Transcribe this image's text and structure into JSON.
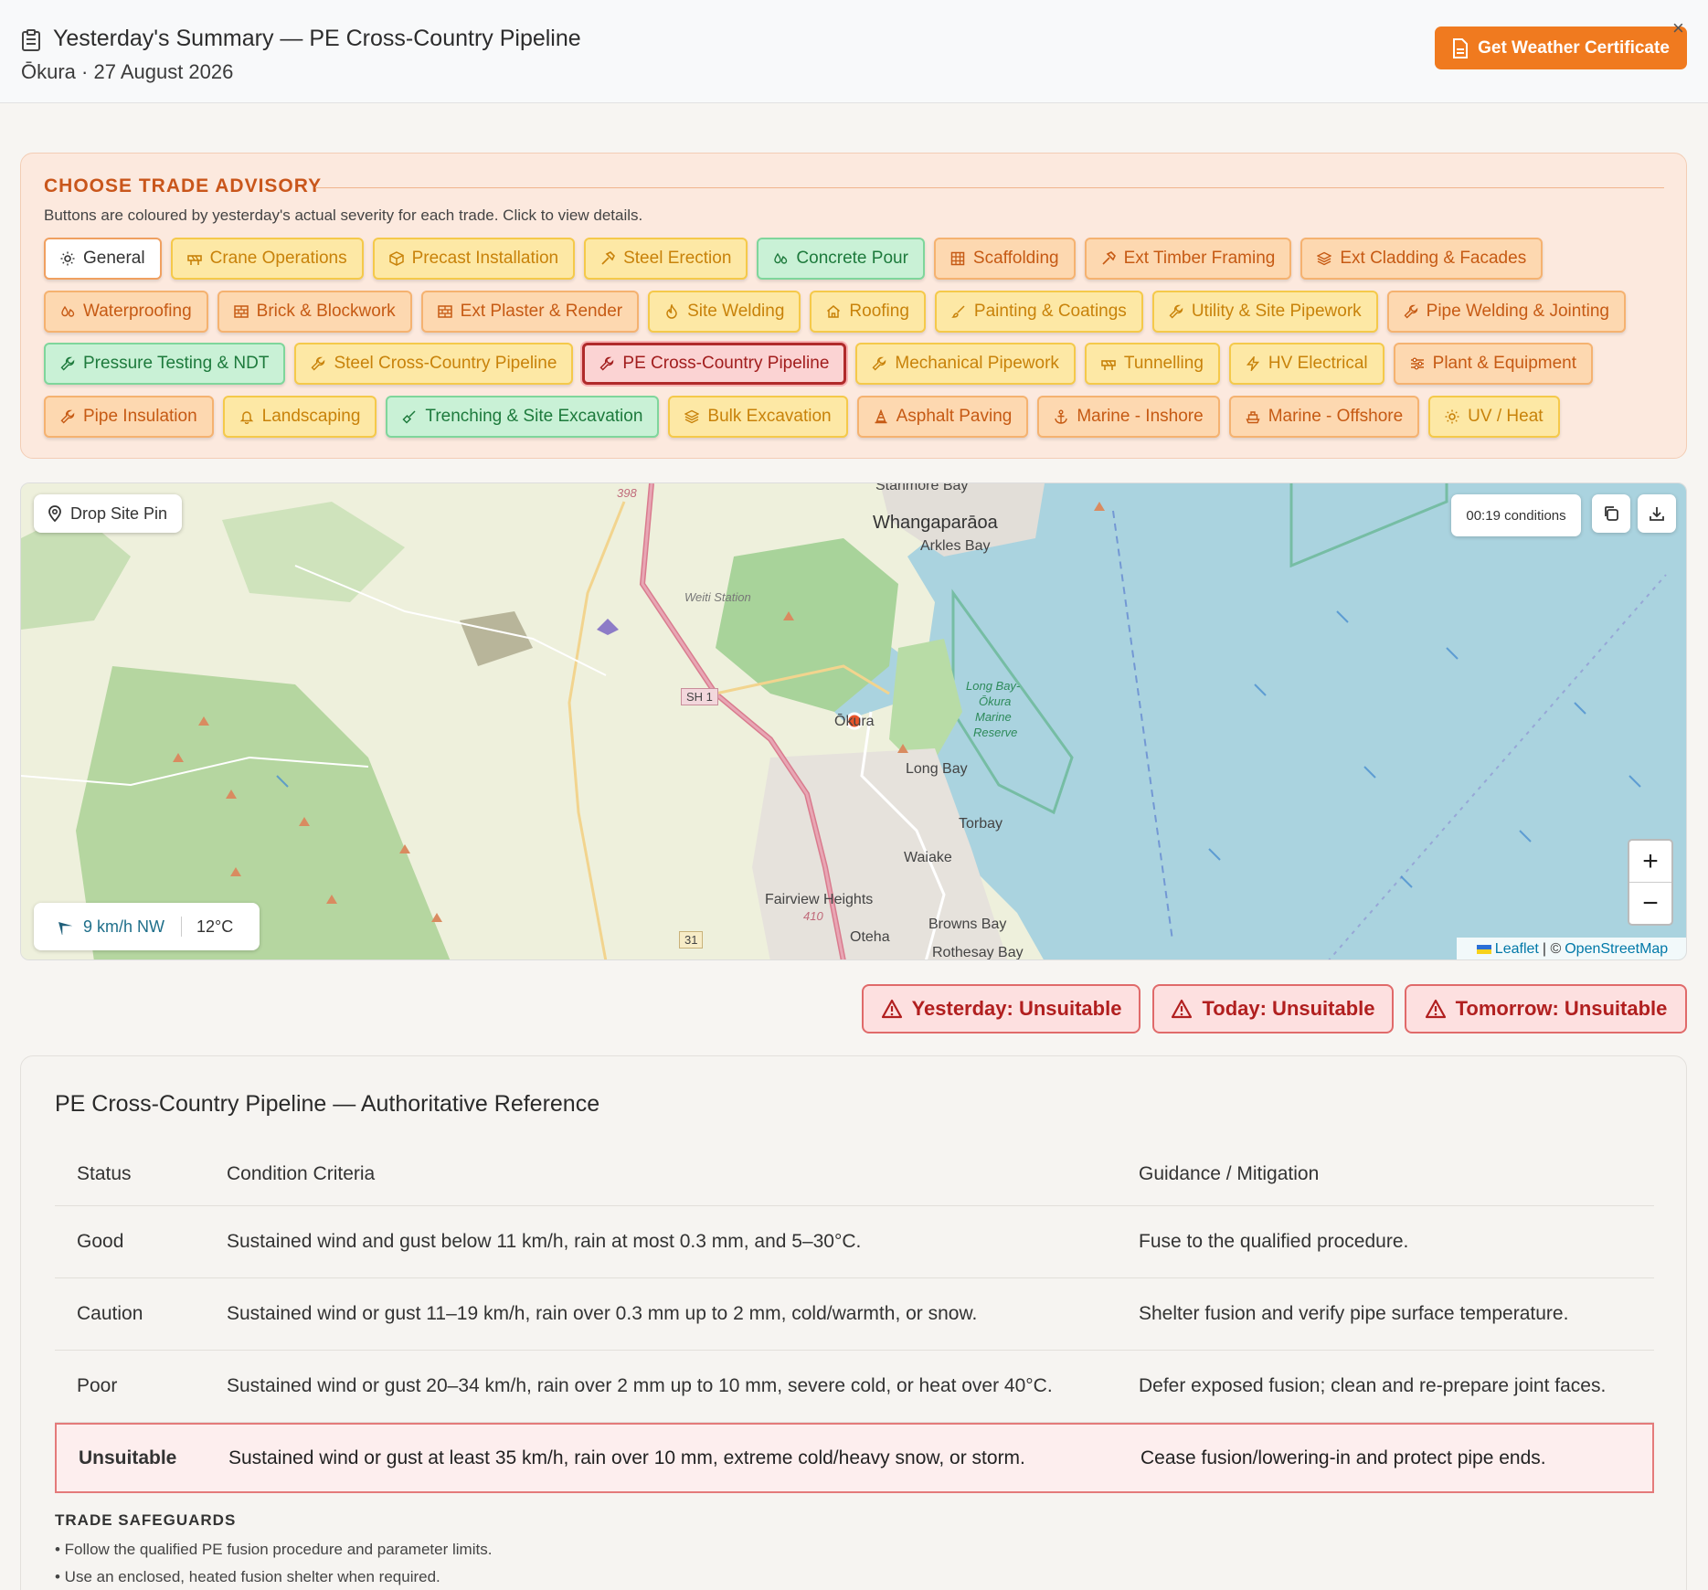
{
  "header": {
    "title": "Yesterday's Summary — PE Cross-Country Pipeline",
    "subtitle": "Ōkura · 27 August 2026",
    "cert_button": "Get Weather Certificate",
    "close": "×"
  },
  "trade": {
    "heading": "CHOOSE TRADE ADVISORY",
    "description": "Buttons are coloured by yesterday's actual severity for each trade. Click to view details.",
    "rows": [
      [
        {
          "label": "General",
          "tone": "w",
          "icon": "sun-icon"
        },
        {
          "label": "Crane Operations",
          "tone": "y",
          "icon": "barrier-icon"
        },
        {
          "label": "Precast Installation",
          "tone": "y",
          "icon": "cube-icon"
        },
        {
          "label": "Steel Erection",
          "tone": "y",
          "icon": "hammer-icon"
        },
        {
          "label": "Concrete Pour",
          "tone": "g",
          "icon": "droplets-icon"
        },
        {
          "label": "Scaffolding",
          "tone": "o",
          "icon": "grid-icon"
        },
        {
          "label": "Ext Timber Framing",
          "tone": "o",
          "icon": "hammer-icon"
        },
        {
          "label": "Ext Cladding & Facades",
          "tone": "o",
          "icon": "layers-icon"
        }
      ],
      [
        {
          "label": "Waterproofing",
          "tone": "o",
          "icon": "droplets-icon"
        },
        {
          "label": "Brick & Blockwork",
          "tone": "o",
          "icon": "brick-icon"
        },
        {
          "label": "Ext Plaster & Render",
          "tone": "o",
          "icon": "brick-icon"
        },
        {
          "label": "Site Welding",
          "tone": "y",
          "icon": "flame-icon"
        },
        {
          "label": "Roofing",
          "tone": "y",
          "icon": "home-icon"
        },
        {
          "label": "Painting & Coatings",
          "tone": "y",
          "icon": "brush-icon"
        },
        {
          "label": "Utility & Site Pipework",
          "tone": "y",
          "icon": "wrench-icon"
        },
        {
          "label": "Pipe Welding & Jointing",
          "tone": "o",
          "icon": "wrench-icon"
        }
      ],
      [
        {
          "label": "Pressure Testing & NDT",
          "tone": "g",
          "icon": "wrench-icon"
        },
        {
          "label": "Steel Cross-Country Pipeline",
          "tone": "y",
          "icon": "wrench-icon"
        },
        {
          "label": "PE Cross-Country Pipeline",
          "tone": "sel",
          "icon": "wrench-icon"
        },
        {
          "label": "Mechanical Pipework",
          "tone": "y",
          "icon": "wrench-icon"
        },
        {
          "label": "Tunnelling",
          "tone": "y",
          "icon": "barrier-icon"
        },
        {
          "label": "HV Electrical",
          "tone": "y",
          "icon": "zap-icon"
        },
        {
          "label": "Plant & Equipment",
          "tone": "o",
          "icon": "sliders-icon"
        }
      ],
      [
        {
          "label": "Pipe Insulation",
          "tone": "o",
          "icon": "wrench-icon"
        },
        {
          "label": "Landscaping",
          "tone": "y",
          "icon": "bell-icon"
        },
        {
          "label": "Trenching & Site Excavation",
          "tone": "g",
          "icon": "shovel-icon"
        },
        {
          "label": "Bulk Excavation",
          "tone": "y",
          "icon": "layers-icon"
        },
        {
          "label": "Asphalt Paving",
          "tone": "o",
          "icon": "cone-icon"
        },
        {
          "label": "Marine - Inshore",
          "tone": "o",
          "icon": "anchor-icon"
        },
        {
          "label": "Marine - Offshore",
          "tone": "o",
          "icon": "ship-icon"
        },
        {
          "label": "UV / Heat",
          "tone": "y",
          "icon": "sun-icon"
        }
      ]
    ]
  },
  "map": {
    "drop_pin": "Drop Site Pin",
    "conditions": "00:19 conditions",
    "zoom_in": "+",
    "zoom_out": "−",
    "wind": "9 km/h NW",
    "temp": "12°C",
    "attrib_leaflet": "Leaflet",
    "attrib_sep": "| ©",
    "attrib_osm": "OpenStreetMap",
    "places": {
      "stanmore": "Stanmore Bay",
      "whangaparaoa": "Whangaparāoa",
      "arkles": "Arkles Bay",
      "weiti": "Weiti Station",
      "sh1": "SH 1",
      "r398": "398",
      "reserve1": "Long Bay-",
      "reserve2": "Ōkura",
      "reserve3": "Marine",
      "reserve4": "Reserve",
      "okura": "Ōkura",
      "longbay": "Long Bay",
      "torbay": "Torbay",
      "waiake": "Waiake",
      "fairview": "Fairview Heights",
      "r410": "410",
      "browns": "Browns Bay",
      "oteha": "Oteha",
      "rothesay": "Rothesay Bay",
      "r31": "31"
    }
  },
  "forecast": {
    "yesterday": "Yesterday: Unsuitable",
    "today": "Today: Unsuitable",
    "tomorrow": "Tomorrow: Unsuitable"
  },
  "reference": {
    "title": "PE Cross-Country Pipeline — Authoritative Reference",
    "columns": [
      "Status",
      "Condition Criteria",
      "Guidance / Mitigation"
    ],
    "rows": [
      {
        "status": "Good",
        "criteria": "Sustained wind and gust below 11 km/h, rain at most 0.3 mm, and 5–30°C.",
        "guidance": "Fuse to the qualified procedure."
      },
      {
        "status": "Caution",
        "criteria": "Sustained wind or gust 11–19 km/h, rain over 0.3 mm up to 2 mm, cold/warmth, or snow.",
        "guidance": "Shelter fusion and verify pipe surface temperature."
      },
      {
        "status": "Poor",
        "criteria": "Sustained wind or gust 20–34 km/h, rain over 2 mm up to 10 mm, severe cold, or heat over 40°C.",
        "guidance": "Defer exposed fusion; clean and re-prepare joint faces."
      },
      {
        "status": "Unsuitable",
        "criteria": "Sustained wind or gust at least 35 km/h, rain over 10 mm, extreme cold/heavy snow, or storm.",
        "guidance": "Cease fusion/lowering-in and protect pipe ends."
      }
    ],
    "safeguards_title": "TRADE SAFEGUARDS",
    "safeguards": [
      "• Follow the qualified PE fusion procedure and parameter limits.",
      "• Use an enclosed, heated fusion shelter when required."
    ]
  },
  "colors": {
    "accent": "#f07a1f",
    "unsuitable": "#b11f1f",
    "sea": "#aad3df"
  }
}
